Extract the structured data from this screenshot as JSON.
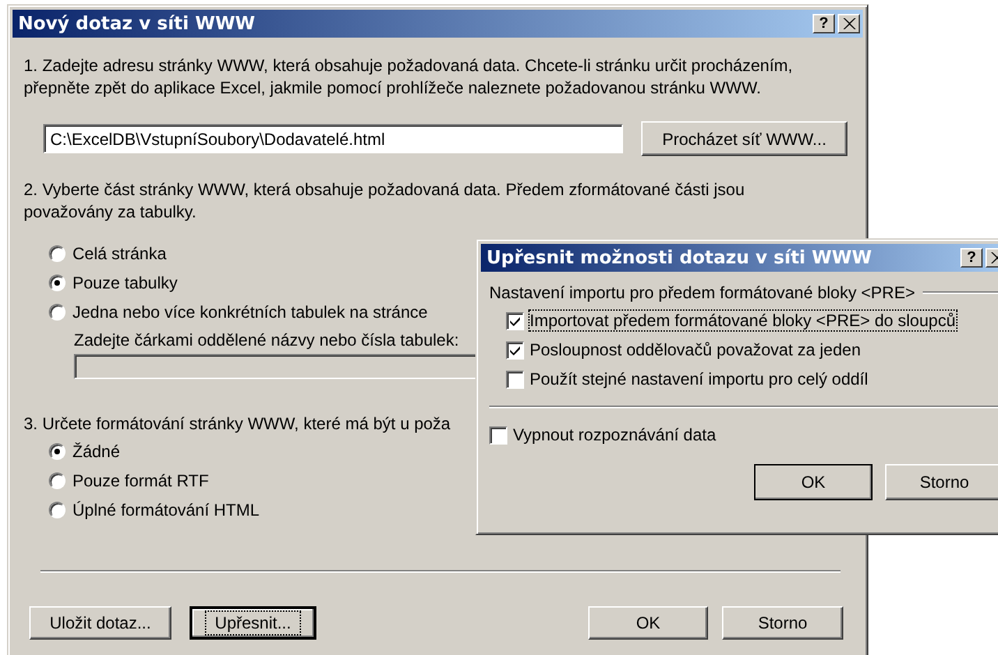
{
  "main_dialog": {
    "title": "Nový dotaz v síti WWW",
    "help_button": "?",
    "step1": "1. Zadejte adresu stránky WWW, která obsahuje požadovaná data. Chcete-li stránku určit procházením, přepněte zpět do aplikace Excel, jakmile pomocí prohlížeče naleznete požadovanou stránku WWW.",
    "address": {
      "value": "C:\\ExcelDB\\VstupníSoubory\\Dodavatelé.html"
    },
    "browse_button": "Procházet síť WWW...",
    "step2": "2. Vyberte část stránky WWW, která obsahuje požadovaná data. Předem zformátované části jsou považovány za tabulky.",
    "part_options": [
      {
        "label": "Celá stránka",
        "selected": false
      },
      {
        "label": "Pouze tabulky",
        "selected": true
      },
      {
        "label": "Jedna nebo více konkrétních tabulek na stránce",
        "selected": false
      }
    ],
    "tables_label": "Zadejte čárkami oddělené názvy nebo čísla tabulek:",
    "step3": "3. Určete formátování stránky WWW, které má být u poža",
    "format_options": [
      {
        "label": "Žádné",
        "selected": true
      },
      {
        "label": "Pouze formát RTF",
        "selected": false
      },
      {
        "label": "Úplné formátování HTML",
        "selected": false
      }
    ],
    "buttons": [
      {
        "label": "Uložit dotaz...",
        "focused": false
      },
      {
        "label": "Upřesnit...",
        "focused": true
      },
      {
        "label": "OK",
        "focused": false
      },
      {
        "label": "Storno",
        "focused": false
      }
    ]
  },
  "options_dialog": {
    "title": "Upřesnit možnosti dotazu v síti WWW",
    "help_button": "?",
    "group_label": "Nastavení importu pro předem formátované bloky <PRE>",
    "pre_options": [
      {
        "label": "Importovat předem formátované bloky <PRE> do sloupců",
        "checked": true,
        "focused": true
      },
      {
        "label": "Posloupnost oddělovačů považovat za jeden",
        "checked": true,
        "focused": false
      },
      {
        "label": "Použít stejné nastavení importu pro celý oddíl",
        "checked": false,
        "focused": false
      }
    ],
    "date_option": {
      "label": "Vypnout rozpoznávání data",
      "checked": false
    },
    "buttons": [
      {
        "label": "OK"
      },
      {
        "label": "Storno"
      }
    ]
  }
}
